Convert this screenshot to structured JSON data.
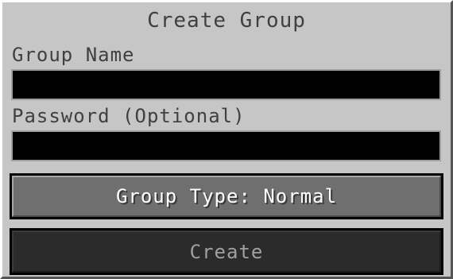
{
  "dialog": {
    "title": "Create Group",
    "group_name": {
      "label": "Group Name",
      "value": "",
      "placeholder": ""
    },
    "password": {
      "label": "Password (Optional)",
      "value": "",
      "placeholder": ""
    },
    "group_type_button": "Group Type: Normal",
    "create_button": "Create"
  },
  "colors": {
    "panel_bg": "#c6c6c6",
    "text_dark": "#404040",
    "field_bg": "#000000",
    "button_bg": "#6f6f6f",
    "button_disabled_bg": "#2b2b2b",
    "button_disabled_text": "#a0a0a0"
  }
}
